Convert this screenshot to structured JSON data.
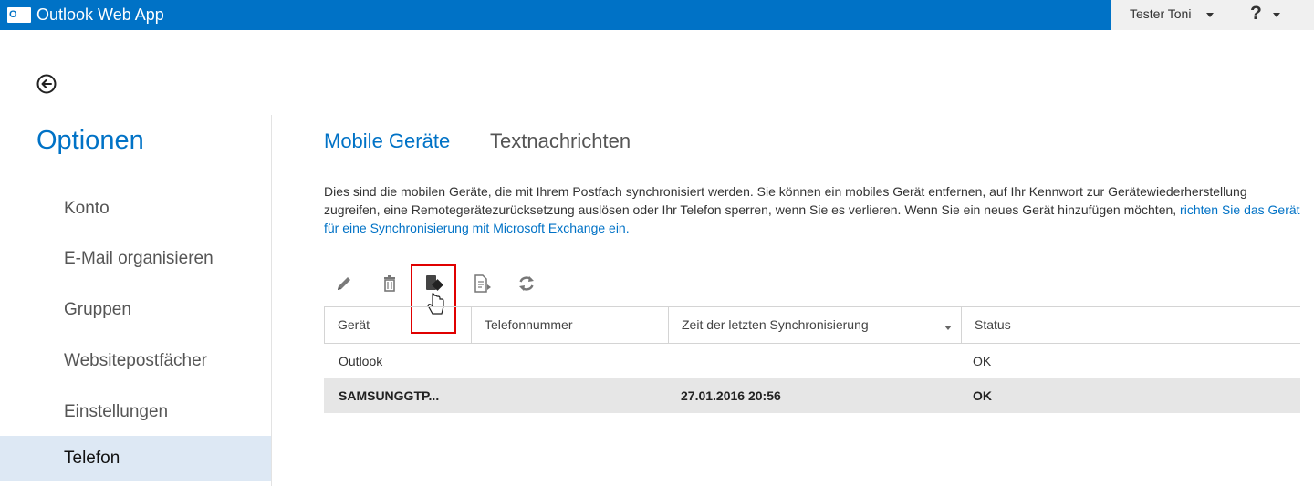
{
  "header": {
    "logo_text": "O",
    "app_title": "Outlook Web App",
    "user_name": "Tester Toni",
    "help_label": "?"
  },
  "nav": {
    "title": "Optionen",
    "items": [
      {
        "label": "Konto"
      },
      {
        "label": "E-Mail organisieren"
      },
      {
        "label": "Gruppen"
      },
      {
        "label": "Websitepostfächer"
      },
      {
        "label": "Einstellungen"
      },
      {
        "label": "Telefon",
        "selected": true
      }
    ]
  },
  "tabs": [
    {
      "label": "Mobile Geräte",
      "active": true
    },
    {
      "label": "Textnachrichten",
      "active": false
    }
  ],
  "description": {
    "text": "Dies sind die mobilen Geräte, die mit Ihrem Postfach synchronisiert werden. Sie können ein mobiles Gerät entfernen, auf Ihr Kennwort zur Gerätewiederherstellung zugreifen, eine Remotegerätezurücksetzung auslösen oder Ihr Telefon sperren, wenn Sie es verlieren. Wenn Sie ein neues Gerät hinzufügen möchten, ",
    "link": "richten Sie das Gerät für eine Synchronisierung mit Microsoft Exchange ein."
  },
  "toolbar": {
    "icons": [
      "pencil-icon",
      "trash-icon",
      "block-device-icon",
      "details-icon",
      "refresh-icon"
    ]
  },
  "table": {
    "columns": [
      "Gerät",
      "Telefonnummer",
      "Zeit der letzten Synchronisierung",
      "Status"
    ],
    "rows": [
      {
        "device": "Outlook",
        "phone": "",
        "last_sync": "",
        "status": "OK"
      },
      {
        "device": "SAMSUNGGTP...",
        "phone": "",
        "last_sync": "27.01.2016 20:56",
        "status": "OK",
        "selected": true
      }
    ]
  },
  "colors": {
    "brand": "#0072c6",
    "selected_nav": "#dde8f4",
    "selected_row": "#e6e6e6",
    "highlight": "#e00000"
  }
}
